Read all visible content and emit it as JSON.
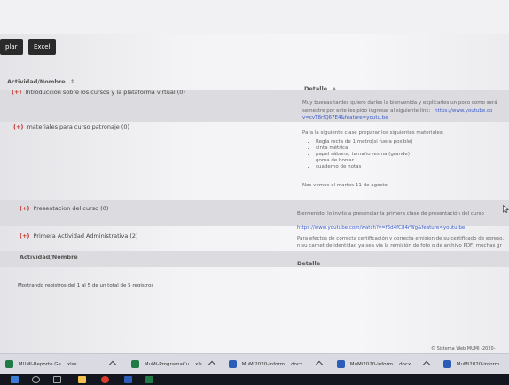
{
  "toolbar": {
    "export_partial": "plar",
    "excel_label": "Excel"
  },
  "table": {
    "col_activity": "Actividad/Nombre",
    "sort_indicator_activity": "↕",
    "col_detail": "Detalle",
    "sort_indicator_detail": "▲",
    "rows": [
      {
        "activity": "Introducción sobre los cursos y la plataforma virtual (0)",
        "detail_lines": [
          "Muy buenas tardes quiero darles la bienvenida y explicarles un poco como será",
          "semestre por este les pido ingresar al siguiente link:"
        ],
        "detail_link_inline": "https://www.youtube.co",
        "detail_link_line2": "v=cvT8rfQ67E4&feature=youtu.be"
      },
      {
        "activity": "materiales para curso patronaje (0)",
        "detail_intro": "Para la siguiente clase preparar los siguientes materiales:",
        "materials": [
          "Regla recta de 1 metro(si fuera posible)",
          "cinta métrica",
          "papel sábana, tamaño resma (grande)",
          "goma de borrar",
          "cuaderno de notas"
        ],
        "detail_outro": "Nos vemos el martes 11 de agosto"
      },
      {
        "activity": "Presentacion del curso (0)",
        "detail_text": "Bienvenido, lo invito a presenciar la primera clase de presentación del curso",
        "detail_link": "https://www.youtube.com/watch?v=f6d4fC84rWg&feature=youtu.be"
      },
      {
        "activity": "Primera Actividad Administrativa (2)",
        "detail_lines": [
          "Para efectos de correcta certificación y correcta emision de su certificado de egreso,",
          "n su carnet de identidad ya sea via la remisión de foto o de archivo PDF, muchas gr"
        ]
      }
    ],
    "plus_marker": "(+)",
    "footer_col_activity": "Actividad/Nombre",
    "footer_col_detail": "Detalle",
    "records_info": "Mostrando registros del 1 al 5 de un total de 5 registros"
  },
  "footer": {
    "copyright": "© Sistema Web MUMI -2020-"
  },
  "taskbar": {
    "items": [
      {
        "label": "MUMI-Reporte Ge....xlsx",
        "icon_color": "#1f7a45",
        "icon": "excel-icon"
      },
      {
        "label": "MuMi-ProgramaCu....xls",
        "icon_color": "#1f7a45",
        "icon": "excel-icon"
      },
      {
        "label": "MuMi2020-inform....docx",
        "icon_color": "#2b5cb8",
        "icon": "word-icon"
      },
      {
        "label": "MuMi2020-inform....docx",
        "icon_color": "#2b5cb8",
        "icon": "word-icon"
      },
      {
        "label": "MuMi2020-inform...",
        "icon_color": "#2b5cb8",
        "icon": "word-icon"
      }
    ]
  },
  "colors": {
    "plus_red": "#c0302a",
    "link_blue": "#3b5bc9",
    "button_dark": "#2a2a2a"
  }
}
